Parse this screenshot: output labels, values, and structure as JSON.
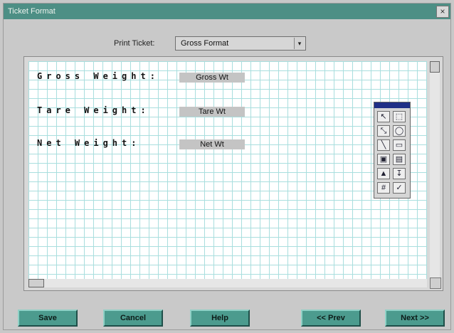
{
  "window": {
    "title": "Ticket Format",
    "close_label": "×"
  },
  "print_ticket": {
    "label": "Print Ticket:",
    "selected": "Gross Format"
  },
  "fields": [
    {
      "label": "Gross Weight:",
      "value": "Gross Wt"
    },
    {
      "label": "Tare Weight:",
      "value": "Tare Wt"
    },
    {
      "label": "Net Weight:",
      "value": "Net Wt"
    }
  ],
  "toolbox": {
    "tools": [
      "↖",
      "⬚",
      "⤡",
      "◯",
      "╲",
      "▭",
      "▣",
      "▤",
      "▲",
      "↧",
      "#",
      "✓"
    ],
    "icons": [
      "pointer-icon",
      "rect-select-icon",
      "resize-icon",
      "ellipse-icon",
      "line-icon",
      "frame-icon",
      "fill-icon",
      "layers-icon",
      "arrow-up-icon",
      "arrow-down-icon",
      "hash-icon",
      "check-icon"
    ]
  },
  "buttons": {
    "save": "Save",
    "cancel": "Cancel",
    "help": "Help",
    "prev": "<< Prev",
    "next": "Next >>"
  },
  "colors": {
    "title_bar": "#4d8f85",
    "button": "#4c9b8e",
    "grid": "#a9dede"
  }
}
